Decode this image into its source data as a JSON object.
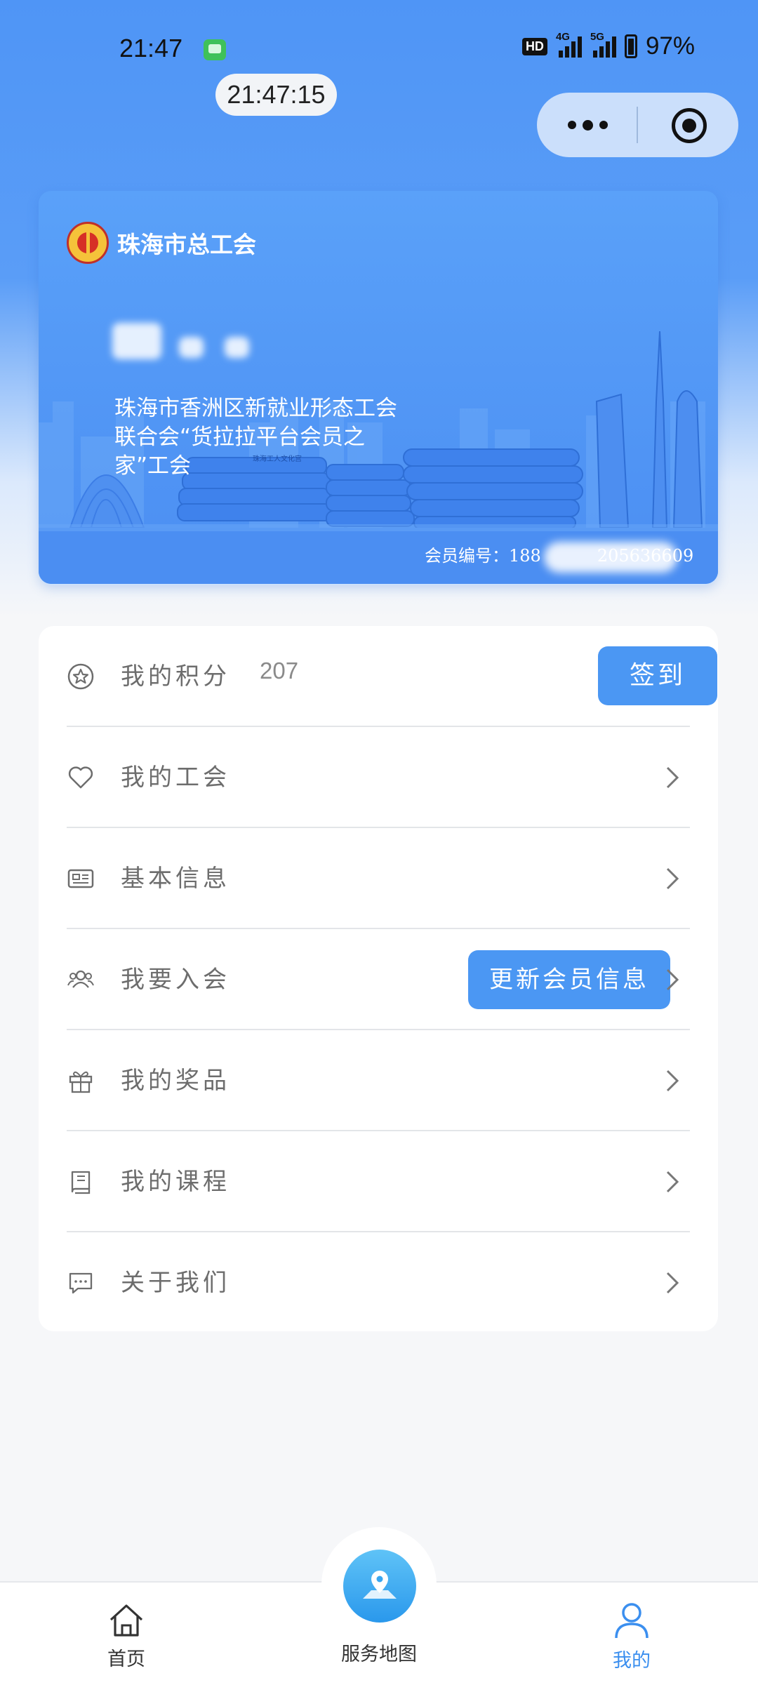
{
  "status_bar": {
    "time": "21:47",
    "hd_label": "HD",
    "net1": "4G",
    "net2": "5G",
    "battery": "97%",
    "timer": "21:47:15"
  },
  "card": {
    "org_name": "珠海市总工会",
    "union_desc": "珠海市香洲区新就业形态工会联合会“货拉拉平台会员之家”工会",
    "member_id_label": "会员编号：188",
    "member_id_tail": "205636609",
    "building_sign": "珠海工人文化宫"
  },
  "menu": {
    "points": {
      "label": "我的积分",
      "value": "207",
      "button": "签到"
    },
    "my_union": "我的工会",
    "basic_info": "基本信息",
    "join": {
      "label": "我要入会",
      "button": "更新会员信息"
    },
    "prizes": "我的奖品",
    "courses": "我的课程",
    "about": "关于我们"
  },
  "nav": {
    "home": "首页",
    "service_map": "服务地图",
    "mine": "我的"
  },
  "colors": {
    "accent": "#4b97f3",
    "card_blue": "#4b8ef2",
    "active_nav": "#3b8fef"
  },
  "icons": [
    "message-app-icon",
    "more-dots-icon",
    "close-miniapp-icon",
    "union-emblem-icon",
    "star-icon",
    "heart-icon",
    "id-card-icon",
    "people-icon",
    "gift-icon",
    "book-icon",
    "chat-icon",
    "chevron-right-icon",
    "home-icon",
    "map-pin-icon",
    "user-icon"
  ]
}
